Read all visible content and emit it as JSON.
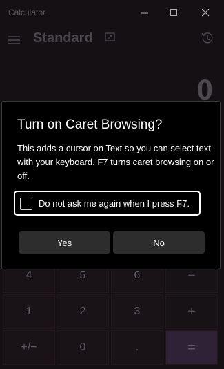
{
  "app": {
    "title": "Calculator"
  },
  "window_controls": {
    "minimize_icon": "minimize-icon",
    "maximize_icon": "maximize-icon",
    "close_icon": "close-icon"
  },
  "header": {
    "mode_title": "Standard",
    "menu_icon": "hamburger-icon",
    "keep_on_top_icon": "keep-on-top-icon",
    "history_icon": "history-icon"
  },
  "display": {
    "value": "0"
  },
  "keypad": {
    "rows": [
      [
        "4",
        "5",
        "6",
        "−"
      ],
      [
        "1",
        "2",
        "3",
        "+"
      ],
      [
        "+/−",
        "0",
        ".",
        "="
      ]
    ]
  },
  "dialog": {
    "title": "Turn on Caret Browsing?",
    "body": "This adds a cursor on Text so you can select text with your keyboard. F7 turns caret browsing on or off.",
    "checkbox_label": "Do not ask me again when I press F7.",
    "checkbox_checked": false,
    "yes_label": "Yes",
    "no_label": "No"
  },
  "colors": {
    "accent_equals": "#3a2a43",
    "dialog_bg": "#000000",
    "button_bg": "#2d2d2d"
  }
}
